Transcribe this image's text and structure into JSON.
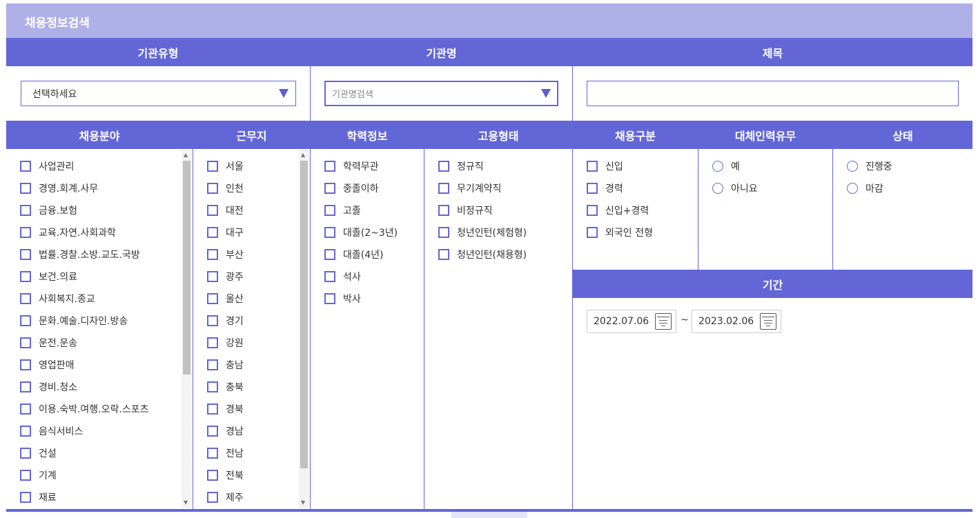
{
  "title": "채용정보검색",
  "headers": {
    "inst_type": "기관유형",
    "inst_name": "기관명",
    "subject": "제목",
    "field": "채용분야",
    "location": "근무지",
    "education": "학력정보",
    "employment": "고용형태",
    "recruit_type": "채용구분",
    "substitute": "대체인력유무",
    "status": "상태",
    "period": "기간"
  },
  "inst_type_select": {
    "value": "선택하세요"
  },
  "inst_name_select": {
    "placeholder": "기관명검색"
  },
  "subject_input": {
    "value": ""
  },
  "fields": [
    "사업관리",
    "경영.회계.사무",
    "금융.보험",
    "교육.자연.사회과학",
    "법률.경찰.소방.교도.국방",
    "보건.의료",
    "사회복지.종교",
    "문화.예술.디자인.방송",
    "운전.운송",
    "영업판매",
    "경비.청소",
    "이용.숙박.여행.오락.스포츠",
    "음식서비스",
    "건설",
    "기계",
    "재료"
  ],
  "locations": [
    "서울",
    "인천",
    "대전",
    "대구",
    "부산",
    "광주",
    "울산",
    "경기",
    "강원",
    "충남",
    "충북",
    "경북",
    "경남",
    "전남",
    "전북",
    "제주"
  ],
  "education": [
    "학력무관",
    "중졸이하",
    "고졸",
    "대졸(2~3년)",
    "대졸(4년)",
    "석사",
    "박사"
  ],
  "employment": [
    "정규직",
    "무기계약직",
    "비정규직",
    "청년인턴(체험형)",
    "청년인턴(채용형)"
  ],
  "recruit_types": [
    "신입",
    "경력",
    "신입+경력",
    "외국인 전형"
  ],
  "substitute_options": [
    "예",
    "아니요"
  ],
  "status_options": [
    "진행중",
    "마감"
  ],
  "period": {
    "start": "2022.07.06",
    "separator": "~",
    "end": "2023.02.06"
  },
  "icons": {
    "dropdown": "triangle-down-icon",
    "calendar": "calendar-icon"
  },
  "colors": {
    "accent": "#6366d6",
    "title_bar": "#b0b0e8"
  }
}
